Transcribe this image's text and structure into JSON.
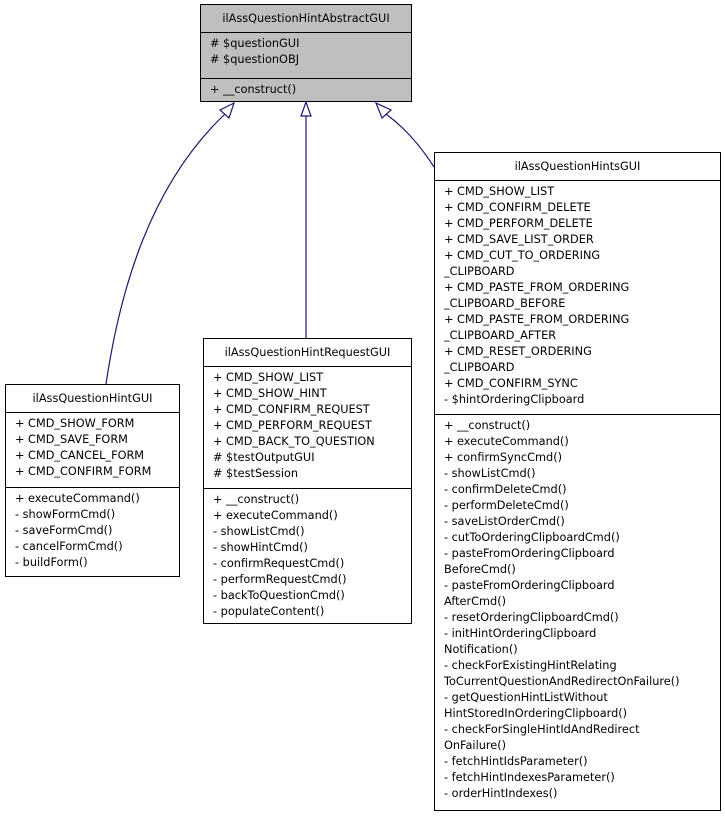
{
  "diagram": {
    "edge_color": "#191970",
    "relation": "inheritance",
    "classes": {
      "abstract": {
        "name": "ilAssQuestionHintAbstractGUI",
        "attributes": [
          "# $questionGUI",
          "# $questionOBJ"
        ],
        "methods": [
          "+ __construct()"
        ],
        "fill": "#bfbfbf"
      },
      "hint": {
        "name": "ilAssQuestionHintGUI",
        "attributes": [
          "+ CMD_SHOW_FORM",
          "+ CMD_SAVE_FORM",
          "+ CMD_CANCEL_FORM",
          "+ CMD_CONFIRM_FORM"
        ],
        "methods": [
          "+ executeCommand()",
          "- showFormCmd()",
          "- saveFormCmd()",
          "- cancelFormCmd()",
          "- buildForm()"
        ]
      },
      "request": {
        "name": "ilAssQuestionHintRequestGUI",
        "attributes": [
          "+ CMD_SHOW_LIST",
          "+ CMD_SHOW_HINT",
          "+ CMD_CONFIRM_REQUEST",
          "+ CMD_PERFORM_REQUEST",
          "+ CMD_BACK_TO_QUESTION",
          "# $testOutputGUI",
          "# $testSession"
        ],
        "methods": [
          "+ __construct()",
          "+ executeCommand()",
          "- showListCmd()",
          "- showHintCmd()",
          "- confirmRequestCmd()",
          "- performRequestCmd()",
          "- backToQuestionCmd()",
          "- populateContent()"
        ]
      },
      "hints": {
        "name": "ilAssQuestionHintsGUI",
        "attributes": [
          "+ CMD_SHOW_LIST",
          "+ CMD_CONFIRM_DELETE",
          "+ CMD_PERFORM_DELETE",
          "+ CMD_SAVE_LIST_ORDER",
          "+ CMD_CUT_TO_ORDERING",
          "_CLIPBOARD",
          "+ CMD_PASTE_FROM_ORDERING",
          "_CLIPBOARD_BEFORE",
          "+ CMD_PASTE_FROM_ORDERING",
          "_CLIPBOARD_AFTER",
          "+ CMD_RESET_ORDERING",
          "_CLIPBOARD",
          "+ CMD_CONFIRM_SYNC",
          "- $hintOrderingClipboard"
        ],
        "methods": [
          "+ __construct()",
          "+ executeCommand()",
          "+ confirmSyncCmd()",
          "- showListCmd()",
          "- confirmDeleteCmd()",
          "- performDeleteCmd()",
          "- saveListOrderCmd()",
          "- cutToOrderingClipboardCmd()",
          "- pasteFromOrderingClipboard",
          "BeforeCmd()",
          "- pasteFromOrderingClipboard",
          "AfterCmd()",
          "- resetOrderingClipboardCmd()",
          "- initHintOrderingClipboard",
          "Notification()",
          "- checkForExistingHintRelating",
          "ToCurrentQuestionAndRedirectOnFailure()",
          "- getQuestionHintListWithout",
          "HintStoredInOrderingClipboard()",
          "- checkForSingleHintIdAndRedirect",
          "OnFailure()",
          "- fetchHintIdsParameter()",
          "- fetchHintIndexesParameter()",
          "- orderHintIndexes()"
        ]
      }
    },
    "edges": [
      {
        "from": "ilAssQuestionHintGUI",
        "to": "ilAssQuestionHintAbstractGUI"
      },
      {
        "from": "ilAssQuestionHintRequestGUI",
        "to": "ilAssQuestionHintAbstractGUI"
      },
      {
        "from": "ilAssQuestionHintsGUI",
        "to": "ilAssQuestionHintAbstractGUI"
      }
    ]
  }
}
